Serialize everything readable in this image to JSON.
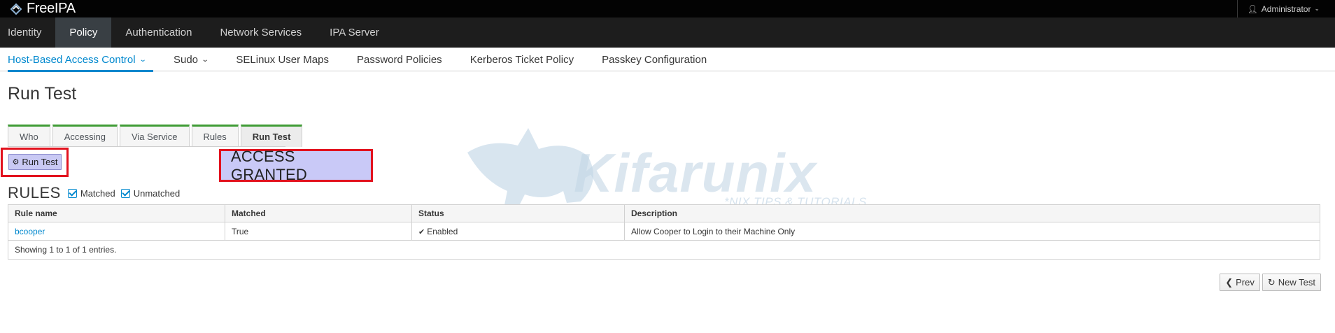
{
  "header": {
    "brand": "FreeIPA",
    "user": "Administrator"
  },
  "primary_nav": [
    "Identity",
    "Policy",
    "Authentication",
    "Network Services",
    "IPA Server"
  ],
  "secondary_nav": [
    "Host-Based Access Control",
    "Sudo",
    "SELinux User Maps",
    "Password Policies",
    "Kerberos Ticket Policy",
    "Passkey Configuration"
  ],
  "page": {
    "title": "Run Test",
    "tabs": [
      "Who",
      "Accessing",
      "Via Service",
      "Rules",
      "Run Test"
    ],
    "run_button": "Run Test",
    "result": "ACCESS GRANTED"
  },
  "rules": {
    "title": "RULES",
    "matched_label": "Matched",
    "unmatched_label": "Unmatched",
    "columns": [
      "Rule name",
      "Matched",
      "Status",
      "Description"
    ],
    "rows": [
      [
        "bcooper",
        "True",
        "Enabled",
        "Allow Cooper to Login to their Machine Only"
      ]
    ],
    "footer": "Showing 1 to 1 of 1 entries."
  },
  "pager": {
    "prev": "Prev",
    "new_test": "New Test"
  },
  "watermark": {
    "title": "Kifarunix",
    "subtitle": "*NIX TIPS & TUTORIALS"
  },
  "colors": {
    "accent": "#0088ce",
    "tab_top": "#3f9c35",
    "highlight": "#e2121e",
    "result_bg": "#c9c9f7"
  }
}
